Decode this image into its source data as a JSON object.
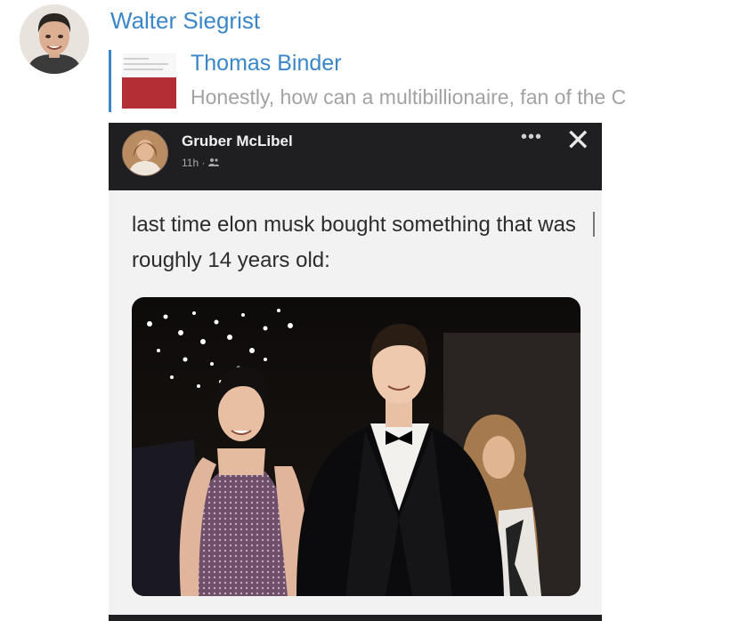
{
  "message": {
    "sender_name": "Walter Siegrist",
    "sender_avatar_icon": "person-photo-avatar",
    "reply": {
      "author": "Thomas Binder",
      "preview": "Honestly, how can a multibillionaire, fan of the C"
    }
  },
  "post": {
    "author": "Gruber McLibel",
    "time": "11h",
    "audience_icon": "friends-icon",
    "more_icon": "more-options-icon",
    "close_icon": "close-icon",
    "text": "last time elon musk bought something that was roughly 14 years old:",
    "image_icon": "party-photo"
  },
  "colors": {
    "accent": "#3a86c8",
    "preview_text": "#a2a2a2",
    "post_header": "#1f1f21",
    "post_body": "#f2f2f2"
  }
}
